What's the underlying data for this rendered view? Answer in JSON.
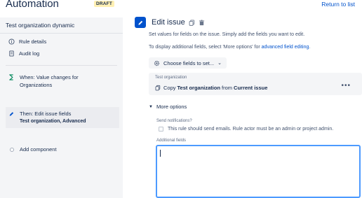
{
  "header": {
    "title": "Automation",
    "badge": "DRAFT",
    "return_link": "Return to list"
  },
  "sidebar": {
    "rule_name": "Test organization dynamic",
    "links": [
      {
        "label": "Rule details",
        "icon": "info-icon"
      },
      {
        "label": "Audit log",
        "icon": "document-icon"
      }
    ],
    "trigger": {
      "icon": "trigger-icon",
      "label": "When: Value changes for",
      "sub": "Organizations"
    },
    "action": {
      "icon": "edit-icon",
      "label": "Then: Edit issue fields",
      "sub": "Test organization, Advanced"
    },
    "add_component": "Add component"
  },
  "main": {
    "title": "Edit issue",
    "desc1": "Set values for fields on the issue. Simply add the fields you want to edit.",
    "desc2_prefix": "To display additional fields, select 'More options' for ",
    "desc2_link": "advanced field editing",
    "desc2_suffix": ".",
    "choose_button": "Choose fields to set...",
    "field": {
      "label": "Test organization",
      "copy": "Copy",
      "field_name": "Test organization",
      "from": "from",
      "source": "Current issue"
    },
    "more_options": "More options",
    "notifications_label": "Send notifications?",
    "notifications_text": "This rule should send emails. Rule actor must be an admin or project admin.",
    "additional_fields_label": "Additional fields",
    "additional_fields_value": ""
  },
  "colors": {
    "accent": "#0052cc",
    "draft_bg": "#fff0b3",
    "focus_border": "#4c9aff",
    "sidebar_bg": "#f4f5f7"
  }
}
